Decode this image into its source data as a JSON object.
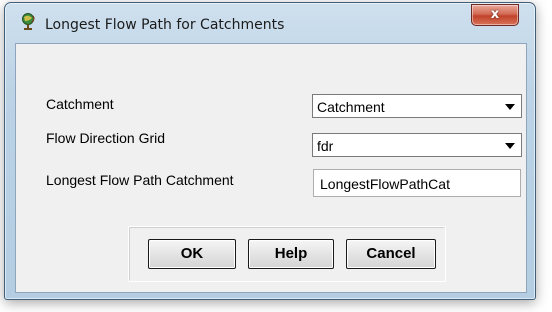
{
  "window": {
    "title": "Longest Flow Path for Catchments",
    "icon": "globe-tool-icon",
    "close_label": "x"
  },
  "form": {
    "catchment": {
      "label": "Catchment",
      "value": "Catchment"
    },
    "flow_direction_grid": {
      "label": "Flow Direction Grid",
      "value": "fdr"
    },
    "longest_flow_path_catchment": {
      "label": "Longest Flow Path Catchment",
      "value": "LongestFlowPathCat"
    }
  },
  "buttons": {
    "ok": "OK",
    "help": "Help",
    "cancel": "Cancel"
  },
  "colors": {
    "frame": "#bcd3e6",
    "client": "#f0f0f0",
    "close": "#c0432a"
  }
}
